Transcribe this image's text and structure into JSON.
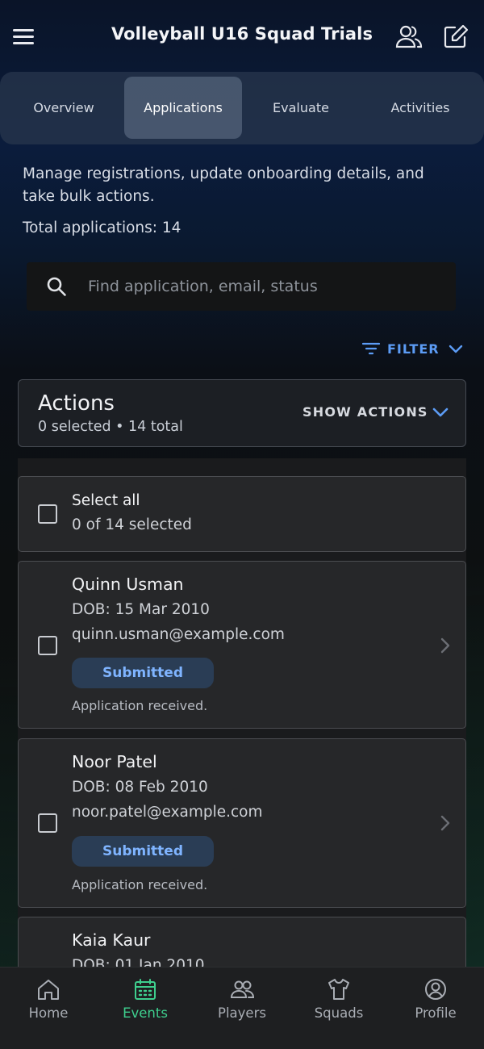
{
  "header": {
    "title": "Volleyball U16 Squad Trials",
    "menu_icon": "hamburger-menu-icon",
    "people_icon": "people-group-icon",
    "edit_icon": "edit-square-icon"
  },
  "tabs": [
    {
      "label": "Overview",
      "active": false
    },
    {
      "label": "Applications",
      "active": true
    },
    {
      "label": "Evaluate",
      "active": false
    },
    {
      "label": "Activities",
      "active": false
    }
  ],
  "main": {
    "description": "Manage registrations, update onboarding details, and take bulk actions.",
    "total_label": "Total applications: 14",
    "search": {
      "placeholder": "Find application, email, status",
      "value": ""
    },
    "filter_label": "FILTER"
  },
  "actions": {
    "title": "Actions",
    "subtitle": "0 selected • 14 total",
    "toggle_label": "SHOW ACTIONS"
  },
  "select_all": {
    "label": "Select all",
    "sub": "0 of 14 selected"
  },
  "applications": [
    {
      "name": "Quinn Usman",
      "dob": "DOB: 15 Mar 2010",
      "email": "quinn.usman@example.com",
      "status": "Submitted",
      "note": "Application received."
    },
    {
      "name": "Noor Patel",
      "dob": "DOB: 08 Feb 2010",
      "email": "noor.patel@example.com",
      "status": "Submitted",
      "note": "Application received."
    },
    {
      "name": "Kaia Kaur",
      "dob": "DOB: 01 Jan 2010"
    }
  ],
  "bottom_nav": [
    {
      "label": "Home",
      "icon": "home-icon",
      "active": false
    },
    {
      "label": "Events",
      "icon": "calendar-icon",
      "active": true
    },
    {
      "label": "Players",
      "icon": "players-icon",
      "active": false
    },
    {
      "label": "Squads",
      "icon": "shirt-icon",
      "active": false
    },
    {
      "label": "Profile",
      "icon": "profile-icon",
      "active": false
    }
  ],
  "colors": {
    "accent_blue": "#5c9cf5",
    "active_nav": "#3ecf8e",
    "badge_bg": "#2a3d55",
    "badge_text": "#7fb4ff"
  }
}
